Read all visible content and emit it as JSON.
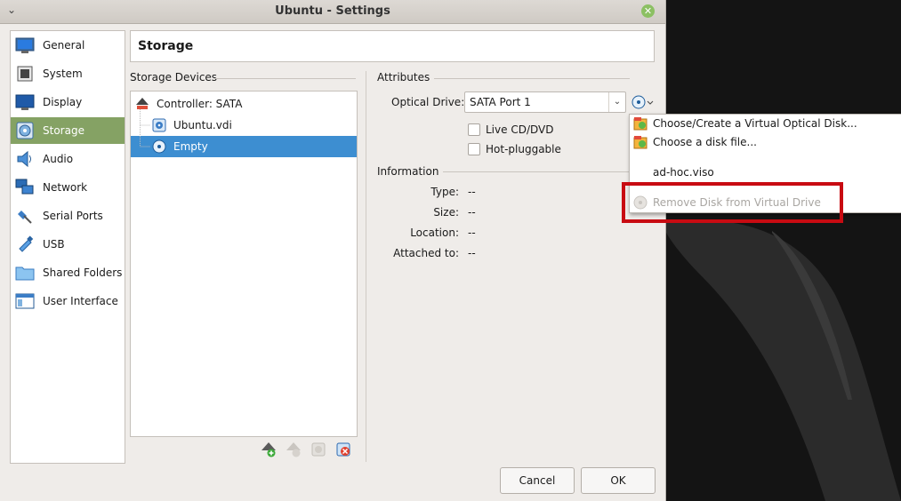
{
  "window": {
    "title": "Ubuntu - Settings",
    "menu_glyph": "⌄",
    "close_glyph": "✕"
  },
  "sidebar": {
    "items": [
      {
        "label": "General",
        "icon": "general-icon"
      },
      {
        "label": "System",
        "icon": "system-icon"
      },
      {
        "label": "Display",
        "icon": "display-icon"
      },
      {
        "label": "Storage",
        "icon": "storage-icon",
        "selected": true
      },
      {
        "label": "Audio",
        "icon": "audio-icon"
      },
      {
        "label": "Network",
        "icon": "network-icon"
      },
      {
        "label": "Serial Ports",
        "icon": "serial-ports-icon"
      },
      {
        "label": "USB",
        "icon": "usb-icon"
      },
      {
        "label": "Shared Folders",
        "icon": "shared-folders-icon"
      },
      {
        "label": "User Interface",
        "icon": "user-interface-icon"
      }
    ]
  },
  "page": {
    "title": "Storage"
  },
  "storage_devices": {
    "label": "Storage Devices",
    "tree": [
      {
        "label": "Controller: SATA",
        "icon": "controller-icon"
      },
      {
        "label": "Ubuntu.vdi",
        "icon": "hard-disk-icon"
      },
      {
        "label": "Empty",
        "icon": "optical-disc-icon",
        "selected": true
      }
    ]
  },
  "attributes": {
    "label": "Attributes",
    "optical_drive_label": "Optical Drive:",
    "optical_drive_value": "SATA Port 1",
    "combo_arrow": "⌄",
    "live_cd_label": "Live CD/DVD",
    "hot_pluggable_label": "Hot-pluggable"
  },
  "information": {
    "label": "Information",
    "rows": [
      {
        "key": "Type:",
        "value": "--"
      },
      {
        "key": "Size:",
        "value": "--"
      },
      {
        "key": "Location:",
        "value": "--"
      },
      {
        "key": "Attached to:",
        "value": "--"
      }
    ]
  },
  "menu": {
    "items": [
      {
        "label": "Choose/Create a Virtual Optical Disk...",
        "icon": "choose-disk-icon"
      },
      {
        "label": "Choose a disk file...",
        "icon": "choose-file-icon"
      },
      {
        "label": "ad-hoc.viso",
        "icon": ""
      },
      {
        "label": "Remove Disk from Virtual Drive",
        "icon": "remove-disk-icon",
        "disabled": true
      }
    ]
  },
  "buttons": {
    "cancel": "Cancel",
    "ok": "OK"
  },
  "colors": {
    "selection": "#3d8ed1",
    "sidebar_selection": "#85a264",
    "highlight": "#c80b12"
  }
}
